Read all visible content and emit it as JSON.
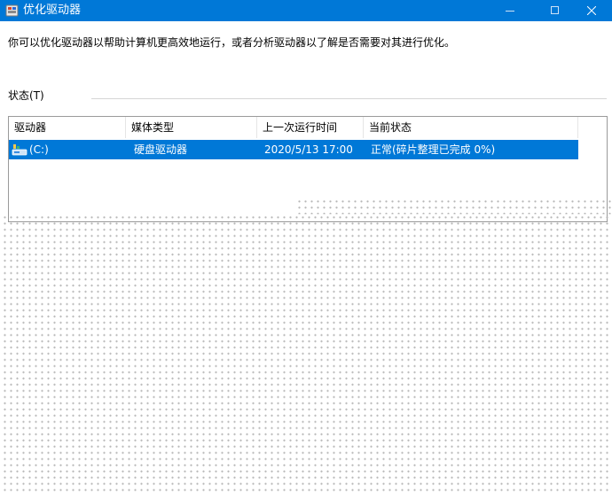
{
  "window": {
    "title": "优化驱动器",
    "controls": {
      "minimize": "minimize",
      "maximize": "maximize",
      "close": "close"
    }
  },
  "description": "你可以优化驱动器以帮助计算机更高效地运行，或者分析驱动器以了解是否需要对其进行优化。",
  "status_section": {
    "label": "状态(T)"
  },
  "drive_list": {
    "columns": [
      "驱动器",
      "媒体类型",
      "上一次运行时间",
      "当前状态"
    ],
    "rows": [
      {
        "drive": "(C:)",
        "media_type": "硬盘驱动器",
        "last_run": "2020/5/13 17:00",
        "status": "正常(碎片整理已完成 0%)",
        "selected": true,
        "icon": "hard-drive-icon"
      }
    ]
  },
  "colors": {
    "accent": "#0078d7",
    "selection_text": "#ffffff",
    "border": "#9a9a9a",
    "divider": "#d6d6d6"
  }
}
